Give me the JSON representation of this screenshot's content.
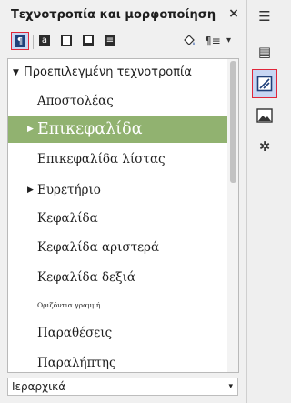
{
  "panel": {
    "title": "Τεχνοτροπία και μορφοποίηση",
    "close_icon": "×"
  },
  "toolbar": {
    "buttons": [
      {
        "icon": "paragraph-styles-icon",
        "glyph": "¶",
        "active": true
      },
      {
        "icon": "character-styles-icon",
        "glyph": "a",
        "active": false
      },
      {
        "icon": "frame-styles-icon",
        "glyph": "□",
        "active": false
      },
      {
        "icon": "page-styles-icon",
        "glyph": "▢",
        "active": false
      },
      {
        "icon": "list-styles-icon",
        "glyph": "≡",
        "active": false
      }
    ],
    "fill_format_icon": "paint-bucket-icon",
    "new_style_glyph": "¶≡",
    "menu_arrow": "▾"
  },
  "styles": {
    "root": {
      "label": "Προεπιλεγμένη τεχνοτροπία",
      "expanded": true
    },
    "items": [
      {
        "label": "Αποστολέας",
        "has_children": false,
        "selected": false
      },
      {
        "label": "Επικεφαλίδα",
        "has_children": true,
        "selected": true
      },
      {
        "label": "Επικεφαλίδα λίστας",
        "has_children": false,
        "selected": false
      },
      {
        "label": "Ευρετήριο",
        "has_children": true,
        "selected": false
      },
      {
        "label": "Κεφαλίδα",
        "has_children": false,
        "selected": false
      },
      {
        "label": "Κεφαλίδα αριστερά",
        "has_children": false,
        "selected": false
      },
      {
        "label": "Κεφαλίδα δεξιά",
        "has_children": false,
        "selected": false
      },
      {
        "label": "Οριζόντια γραμμή",
        "has_children": false,
        "selected": false,
        "small": true
      },
      {
        "label": "Παραθέσεις",
        "has_children": false,
        "selected": false
      },
      {
        "label": "Παραλήπτης",
        "has_children": false,
        "selected": false
      }
    ]
  },
  "filter": {
    "value": "Ιεραρχικά",
    "arrow": "▾"
  },
  "sidebar_tabs": [
    {
      "icon": "sidebar-menu-icon",
      "glyph": "☰",
      "active": false
    },
    {
      "icon": "properties-icon",
      "glyph": "▤",
      "active": false
    },
    {
      "icon": "styles-icon",
      "glyph": "◪",
      "active": true
    },
    {
      "icon": "gallery-icon",
      "glyph": "▨",
      "active": false
    },
    {
      "icon": "navigator-icon",
      "glyph": "✲",
      "active": false
    }
  ],
  "colors": {
    "selected_row": "#91b270",
    "active_tab": "#c7d6f3",
    "active_border": "#e0263a"
  }
}
